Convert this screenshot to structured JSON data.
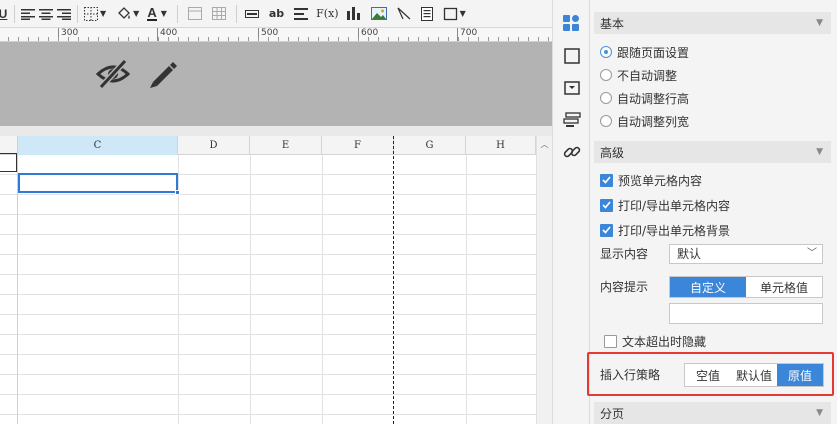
{
  "toolbar": {
    "items": [
      {
        "name": "underline-icon",
        "glyph": "U"
      },
      {
        "name": "align-left-icon"
      },
      {
        "name": "align-center-icon"
      },
      {
        "name": "align-right-icon"
      },
      {
        "name": "border-icon"
      },
      {
        "name": "fill-color-icon"
      },
      {
        "name": "font-color-icon",
        "glyph": "A"
      },
      {
        "name": "merge-cells-icon"
      },
      {
        "name": "split-cells-icon"
      },
      {
        "name": "text-field-icon"
      },
      {
        "name": "text-icon",
        "glyph": "ab"
      },
      {
        "name": "paragraph-icon"
      },
      {
        "name": "formula-icon",
        "glyph": "F(x)"
      },
      {
        "name": "chart-icon"
      },
      {
        "name": "image-icon"
      },
      {
        "name": "slash-icon"
      },
      {
        "name": "subreport-icon"
      },
      {
        "name": "frame-icon"
      }
    ]
  },
  "ruler": {
    "labels": [
      "300",
      "400",
      "500",
      "600",
      "700"
    ]
  },
  "band_icons": {
    "hide": "eye-slash-icon",
    "edit": "pencil-icon"
  },
  "grid": {
    "columns": [
      "C",
      "D",
      "E",
      "F",
      "G",
      "H"
    ],
    "active_column": "C"
  },
  "side_tabs": [
    "cell-attributes-icon",
    "cell-style-icon",
    "condition-icon",
    "widget-icon",
    "hyperlink-icon"
  ],
  "panel": {
    "basic_title": "基本",
    "basic_options": [
      "跟随页面设置",
      "不自动调整",
      "自动调整行高",
      "自动调整列宽"
    ],
    "basic_selected": 0,
    "advanced_title": "高级",
    "advanced_checks": [
      {
        "label": "预览单元格内容",
        "checked": true
      },
      {
        "label": "打印/导出单元格内容",
        "checked": true
      },
      {
        "label": "打印/导出单元格背景",
        "checked": true
      }
    ],
    "display_label": "显示内容",
    "display_value": "默认",
    "hint_label": "内容提示",
    "hint_options": [
      "自定义",
      "单元格值"
    ],
    "hint_selected": 0,
    "hint_input_value": "",
    "hide_overflow_label": "文本超出时隐藏",
    "hide_overflow_checked": false,
    "insert_label": "插入行策略",
    "insert_options": [
      "空值",
      "默认值",
      "原值"
    ],
    "insert_selected": 2,
    "paging_title": "分页"
  }
}
